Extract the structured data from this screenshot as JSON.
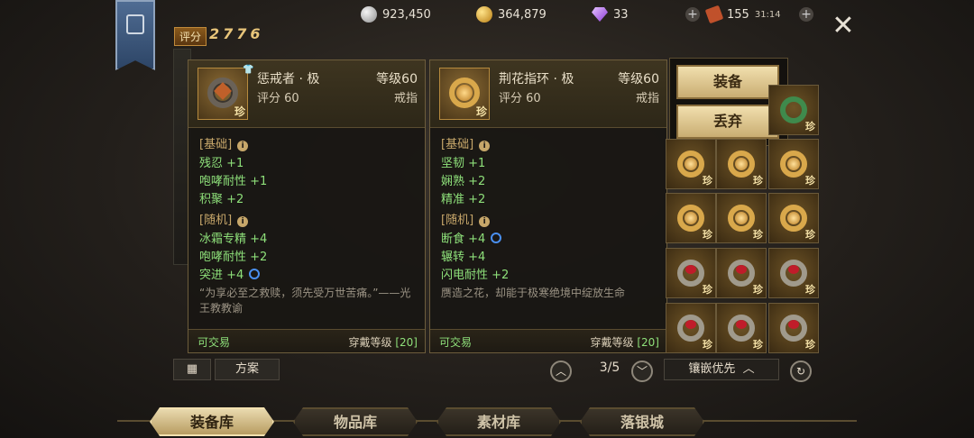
{
  "currencies": {
    "silver": "923,450",
    "gold": "364,879",
    "diamond": "33",
    "ticket": "155",
    "ticket_timer": "31:14"
  },
  "score": {
    "label": "评分",
    "value": "2776"
  },
  "item_left": {
    "name": "惩戒者 · 极",
    "level": "等级60",
    "score": "评分 60",
    "type": "戒指",
    "rare": "珍",
    "base_title": "[基础]",
    "base": [
      "残忍 +1",
      "咆哮耐性 +1",
      "积聚 +2"
    ],
    "random_title": "[随机]",
    "random": [
      "冰霜专精 +4",
      "咆哮耐性 +2",
      "突进 +4"
    ],
    "flavor": "“为享必至之救赎，须先受万世苦痛。”——光王教教谕",
    "tradable": "可交易",
    "req_label": "穿戴等级",
    "req_value": "[20]"
  },
  "item_right": {
    "name": "荆花指环 · 极",
    "level": "等级60",
    "score": "评分 60",
    "type": "戒指",
    "rare": "珍",
    "base_title": "[基础]",
    "base": [
      "坚韧 +1",
      "娴熟 +2",
      "精准 +2"
    ],
    "random_title": "[随机]",
    "random": [
      "断食 +4",
      "辗转 +4",
      "闪电耐性 +2"
    ],
    "flavor": "赝造之花，却能于极寒绝境中绽放生命",
    "tradable": "可交易",
    "req_label": "穿戴等级",
    "req_value": "[20]"
  },
  "actions": {
    "equip": "装备",
    "discard": "丢弃"
  },
  "inventory": {
    "rare": "珍"
  },
  "controls": {
    "plan": "方案",
    "page": "3/5",
    "sort": "镶嵌优先"
  },
  "tabs": [
    "装备库",
    "物品库",
    "素材库",
    "落银城"
  ],
  "colors": {
    "stat_green": "#8ee07a",
    "gold_frame": "#b68a3e"
  }
}
